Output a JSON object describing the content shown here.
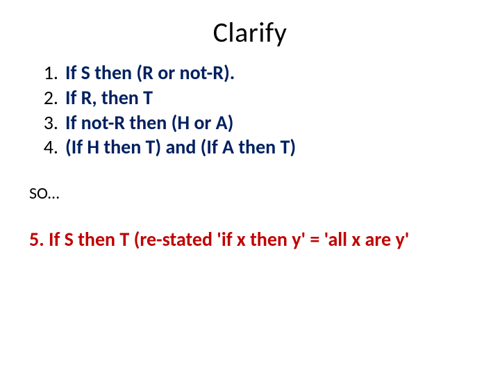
{
  "title": "Clarify",
  "list": {
    "n1": "1.",
    "n2": "2.",
    "n3": "3.",
    "n4": "4.",
    "i1": "If  S then  (R or not-R).",
    "i2": "If R, then T",
    "i3": "If not-R then (H or A)",
    "i4": "(If H then T) and (If A then T)"
  },
  "so": "SO…",
  "conclusion": "5. If S then T  (re-stated  'if x then y' = 'all x are y'"
}
